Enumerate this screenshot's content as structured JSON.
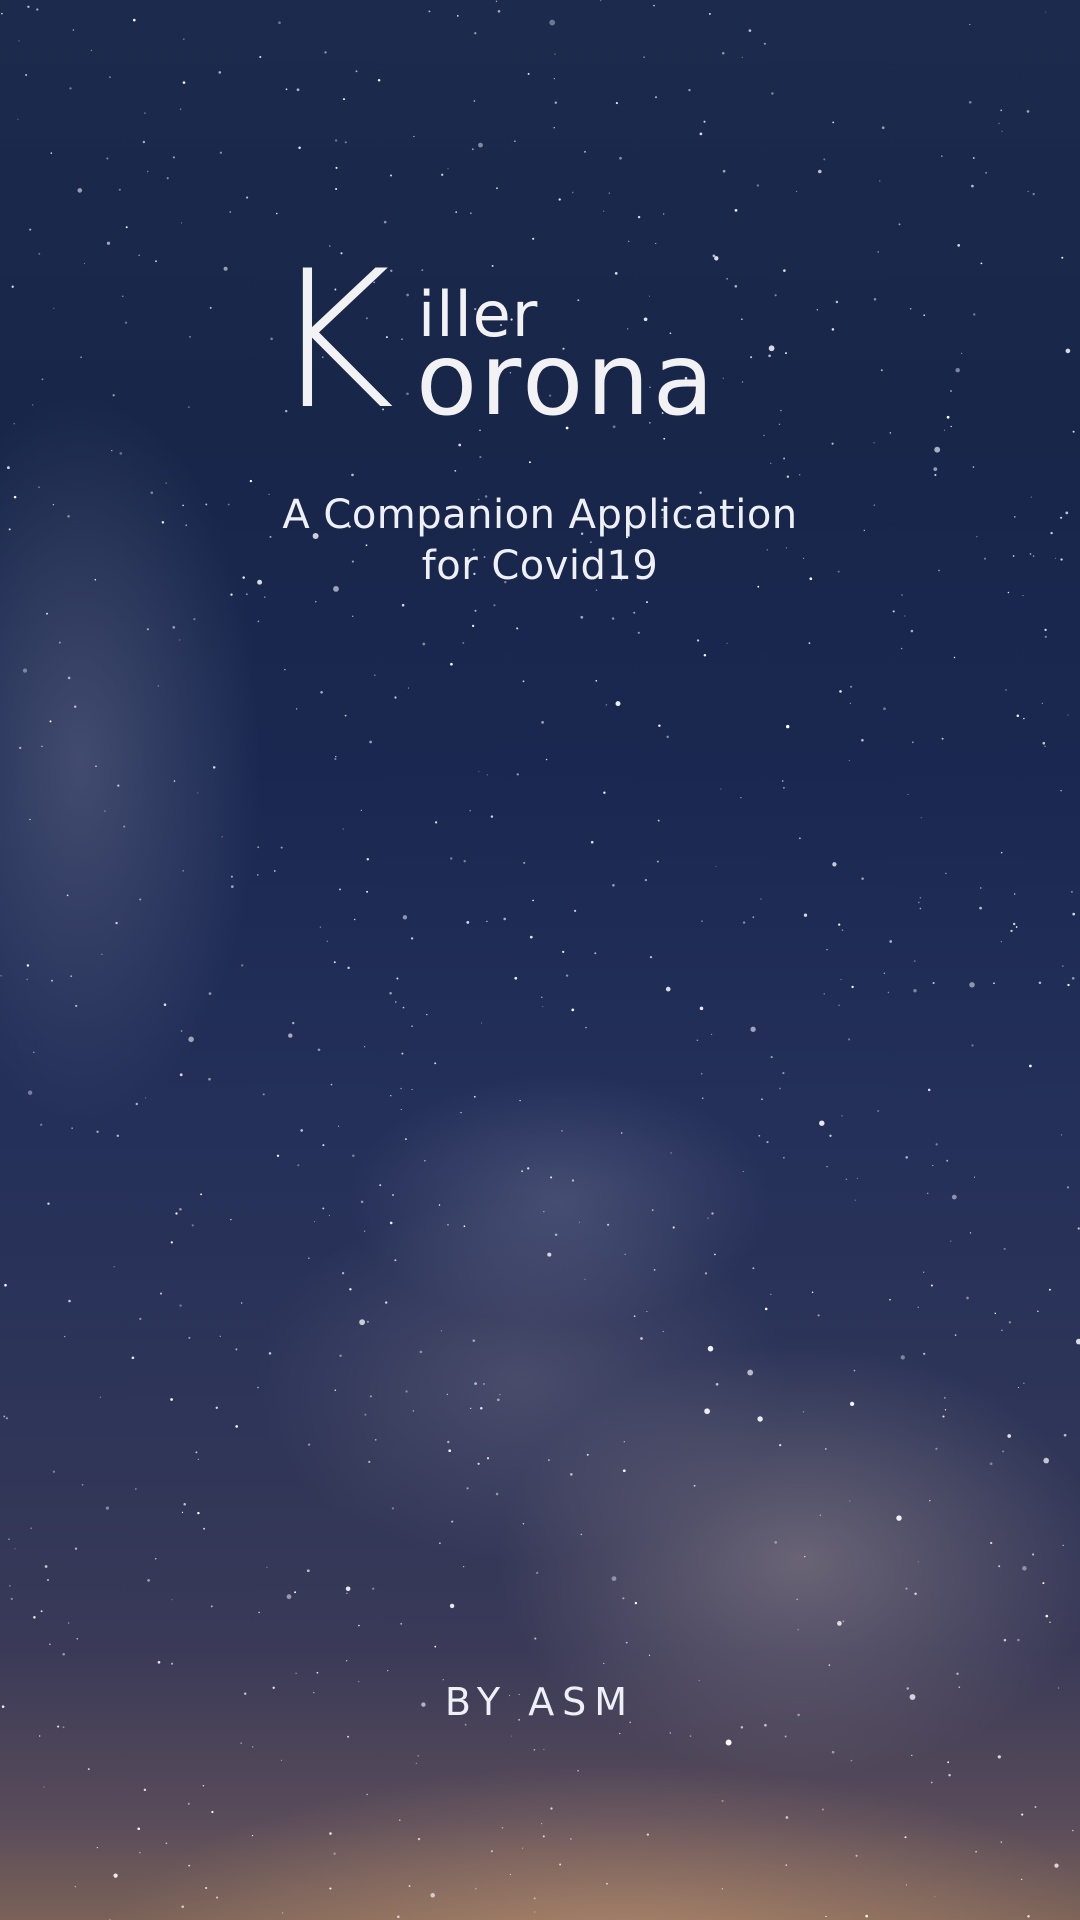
{
  "logo": {
    "big_letter": "K",
    "word_top": "iller",
    "word_bottom": "orona"
  },
  "tagline": {
    "line1": "A Companion Application",
    "line2": "for Covid19"
  },
  "byline": "BY ASM",
  "colors": {
    "sky_top": "#1c2a4d",
    "sky_bottom": "#7a6258",
    "text": "#f2f2f4"
  }
}
